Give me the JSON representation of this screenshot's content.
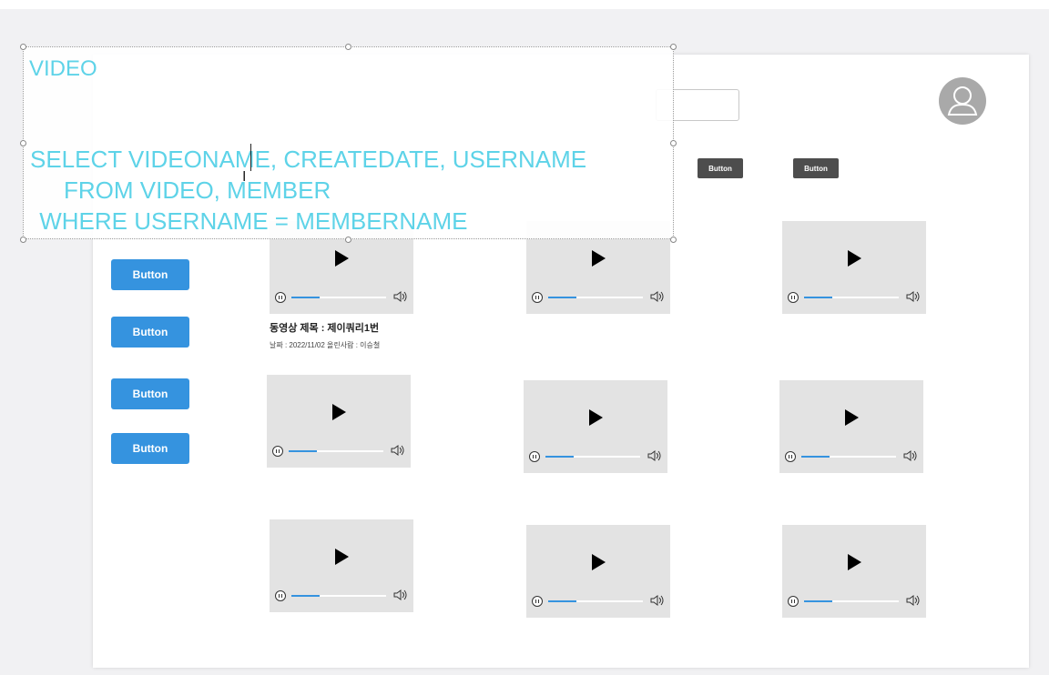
{
  "overlay": {
    "title": "VIDEO",
    "sql_line1": "SELECT VIDEONAME, CREATEDATE, USERNAME",
    "sql_line2": "FROM VIDEO, MEMBER",
    "sql_line3": " WHERE USERNAME = MEMBERNAME"
  },
  "header": {
    "top_buttons": [
      "Button",
      "Button"
    ],
    "avatar_icon": "user-avatar-icon"
  },
  "sidebar": {
    "buttons": [
      "Button",
      "Button",
      "Button",
      "Button"
    ]
  },
  "videos": {
    "count": 9,
    "icons": [
      "play-icon",
      "pause-icon",
      "volume-icon"
    ],
    "progress_fraction": 0.3,
    "first_caption": {
      "title": "동영상 제목 : 제이쿼리1번",
      "meta": "날짜 : 2022/11/02  올린사람 : 이승철"
    }
  },
  "colors": {
    "accent_blue": "#3593df",
    "sql_text": "#5ed3e8",
    "dark_button": "#4d4d4d",
    "video_bg": "#e3e3e3"
  }
}
